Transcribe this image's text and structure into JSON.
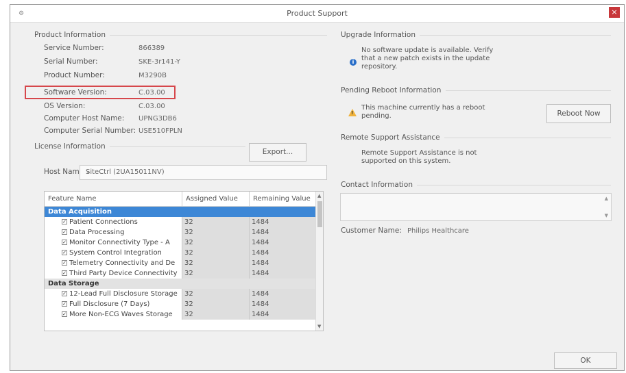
{
  "window": {
    "title": "Product Support",
    "close_glyph": "×"
  },
  "product_info": {
    "group_title": "Product Information",
    "fields": [
      {
        "label": "Service Number:",
        "value": "866389"
      },
      {
        "label": "Serial Number:",
        "value": "SKE-3r141-Y"
      },
      {
        "label": "Product Number:",
        "value": "M3290B"
      },
      {
        "label": "Software Version:",
        "value": "C.03.00"
      },
      {
        "label": "OS Version:",
        "value": "C.03.00"
      },
      {
        "label": "Computer Host Name:",
        "value": "UPNG3DB6"
      },
      {
        "label": "Computer Serial Number:",
        "value": "USE510FPLN"
      }
    ]
  },
  "license": {
    "group_title": "License Information",
    "export_label": "Export...",
    "host_label": "Host Name:",
    "host_value": "SiteCtrl (2UA15011NV)",
    "columns": [
      "Feature Name",
      "Assigned Value",
      "Remaining Value"
    ],
    "categories": [
      {
        "name": "Data Acquisition",
        "selected": true,
        "rows": [
          {
            "name": "Patient Connections",
            "assigned": "32",
            "remaining": "1484"
          },
          {
            "name": "Data Processing",
            "assigned": "32",
            "remaining": "1484"
          },
          {
            "name": "Monitor Connectivity Type - A",
            "assigned": "32",
            "remaining": "1484"
          },
          {
            "name": "System Control Integration",
            "assigned": "32",
            "remaining": "1484"
          },
          {
            "name": "Telemetry Connectivity and De",
            "assigned": "32",
            "remaining": "1484"
          },
          {
            "name": "Third Party Device Connectivity",
            "assigned": "32",
            "remaining": "1484"
          }
        ]
      },
      {
        "name": "Data Storage",
        "selected": false,
        "rows": [
          {
            "name": "12-Lead Full Disclosure Storage",
            "assigned": "32",
            "remaining": "1484"
          },
          {
            "name": "Full Disclosure (7 Days)",
            "assigned": "32",
            "remaining": "1484"
          },
          {
            "name": "More Non-ECG Waves Storage",
            "assigned": "32",
            "remaining": "1484"
          }
        ]
      }
    ]
  },
  "upgrade": {
    "group_title": "Upgrade Information",
    "message_lines": [
      "No software update is available. Verify",
      "that a new patch exists in the update",
      "repository."
    ]
  },
  "pending_reboot": {
    "group_title": "Pending Reboot Information",
    "message_lines": [
      "This machine currently has a reboot",
      "pending."
    ],
    "reboot_button": "Reboot Now"
  },
  "remote_support": {
    "group_title": "Remote Support Assistance",
    "message_lines": [
      "Remote Support Assistance is not",
      "supported on this system."
    ]
  },
  "contact": {
    "group_title": "Contact Information",
    "customer_label": "Customer Name:",
    "customer_value": "Philips Healthcare"
  },
  "footer": {
    "ok_label": "OK"
  }
}
